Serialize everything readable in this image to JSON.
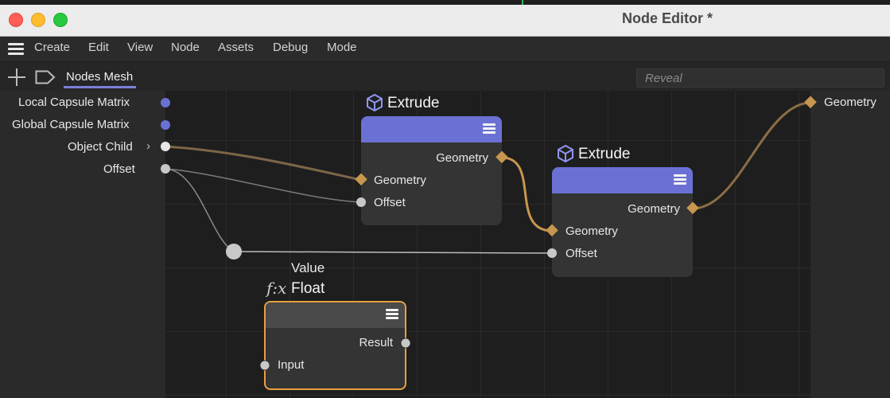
{
  "window": {
    "title": "Node Editor *"
  },
  "menu": [
    "Create",
    "Edit",
    "View",
    "Node",
    "Assets",
    "Debug",
    "Mode"
  ],
  "toolbar": {
    "tab": "Nodes Mesh",
    "search_placeholder": "Reveal"
  },
  "inputs": [
    {
      "label": "Local Capsule Matrix"
    },
    {
      "label": "Global Capsule Matrix"
    },
    {
      "label": "Object Child",
      "chevron": "›"
    },
    {
      "label": "Offset"
    }
  ],
  "outputs": [
    {
      "label": "Geometry"
    }
  ],
  "nodes": {
    "extrude1": {
      "title": "Extrude",
      "out": "Geometry",
      "in1": "Geometry",
      "in2": "Offset"
    },
    "extrude2": {
      "title": "Extrude",
      "out": "Geometry",
      "in1": "Geometry",
      "in2": "Offset"
    },
    "float": {
      "caption": "Value",
      "fx": "f:x",
      "title": "Float",
      "out": "Result",
      "in1": "Input"
    }
  },
  "colors": {
    "accent": "#6b71d4",
    "geometry_wire": "#b88a4a",
    "value_wire": "#cfcfcf",
    "selected_border": "#e8a03f"
  }
}
